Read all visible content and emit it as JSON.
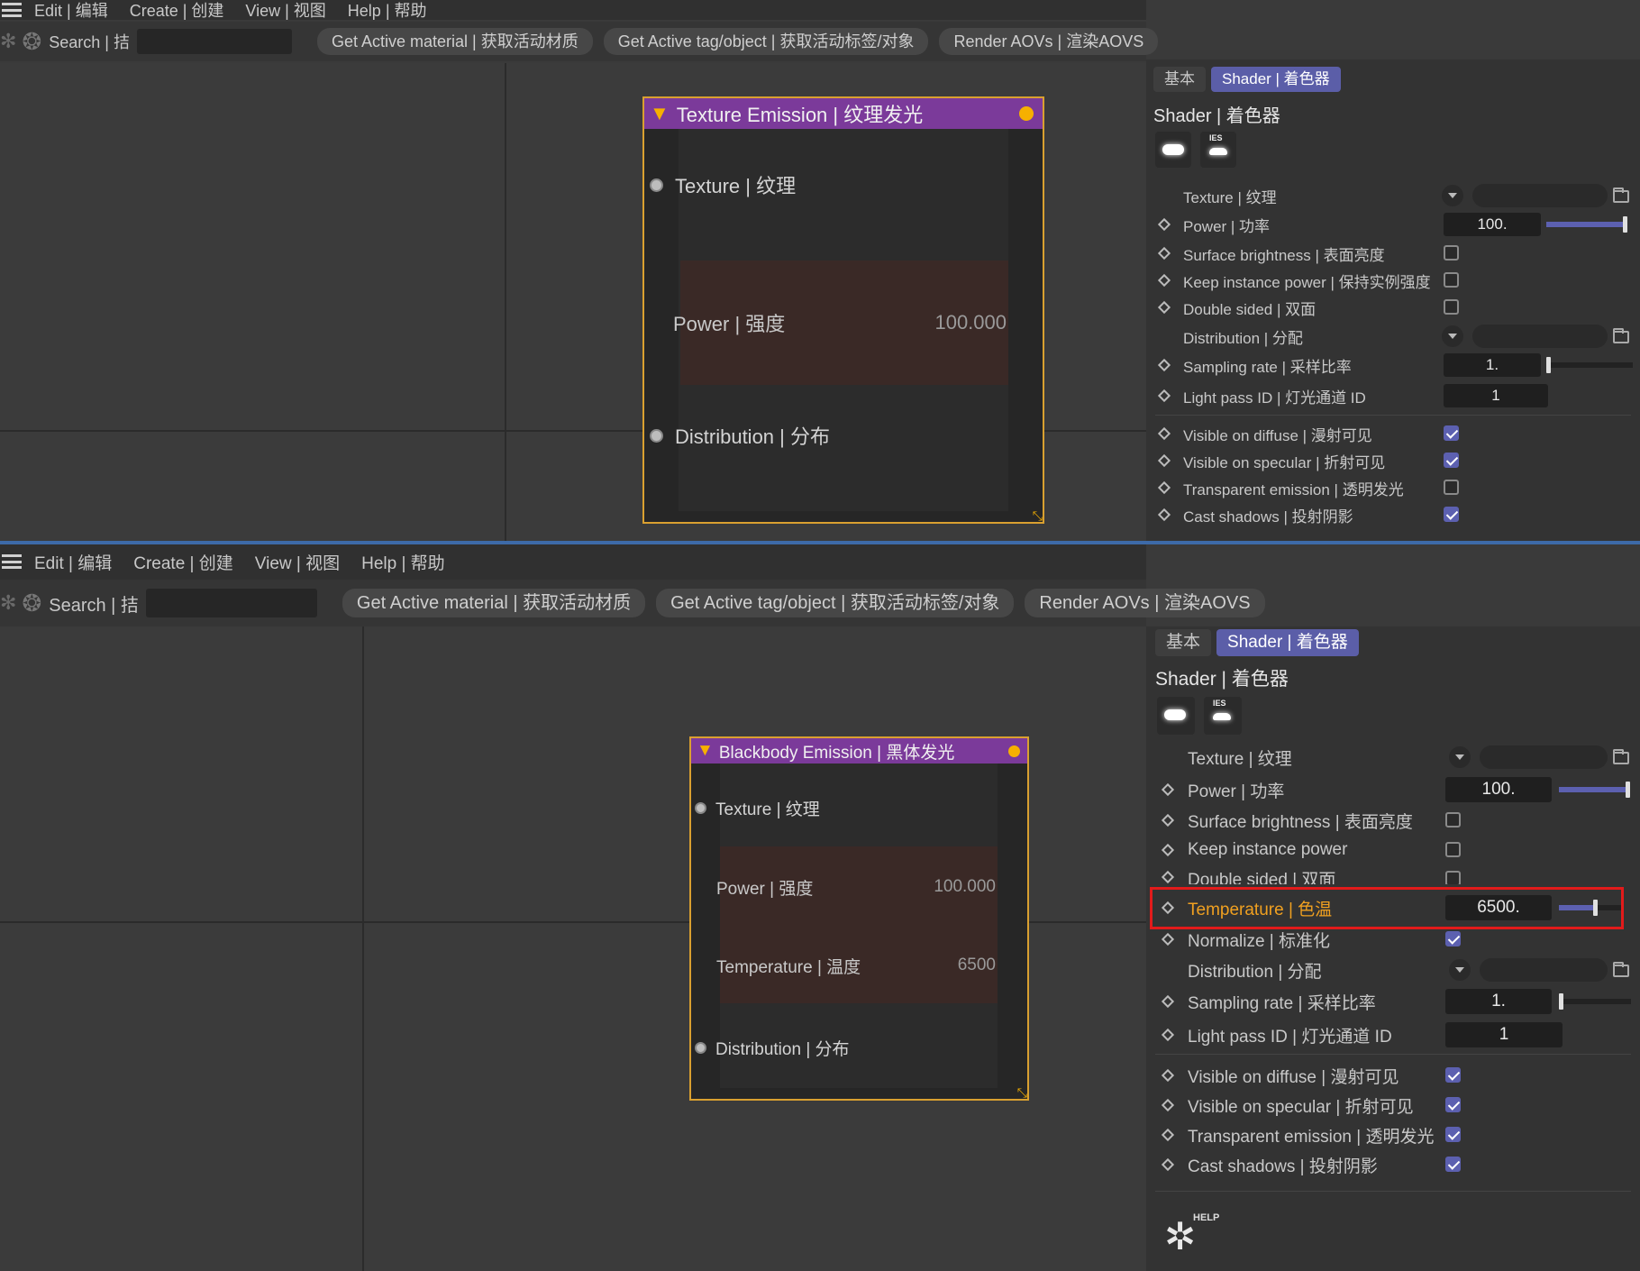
{
  "panelA": {
    "menu": [
      "Edit | 编辑",
      "Create | 创建",
      "View | 视图",
      "Help | 帮助"
    ],
    "search_label": "Search | 拮",
    "search_value": "",
    "toolbar_buttons": [
      "Get Active material | 获取活动材质",
      "Get Active tag/object | 获取活动标签/对象",
      "Render AOVs | 渲染AOVS"
    ],
    "node": {
      "title": "Texture Emission | 纹理发光",
      "texture_label": "Texture | 纹理",
      "power_label": "Power | 强度",
      "power_value": "100.000",
      "distribution_label": "Distribution | 分布"
    },
    "tabs": [
      "基本",
      "Shader | 着色器"
    ],
    "section_title": "Shader | 着色器",
    "props": {
      "texture": "Texture | 纹理",
      "power": "Power | 功率",
      "power_value": "100.",
      "surface_brightness": "Surface brightness | 表面亮度",
      "keep_instance_power": "Keep instance power | 保持实例强度",
      "double_sided": "Double sided | 双面",
      "distribution": "Distribution | 分配",
      "sampling_rate": "Sampling rate | 采样比率",
      "sampling_rate_value": "1.",
      "light_pass_id": "Light pass ID | 灯光通道 ID",
      "light_pass_id_value": "1",
      "visible_diffuse": "Visible on diffuse | 漫射可见",
      "visible_specular": "Visible on specular | 折射可见",
      "transparent_emission": "Transparent emission | 透明发光",
      "cast_shadows": "Cast shadows | 投射阴影"
    },
    "checks": {
      "surface_brightness": false,
      "keep_instance_power": false,
      "double_sided": false,
      "visible_diffuse": true,
      "visible_specular": true,
      "transparent_emission": false,
      "cast_shadows": true
    }
  },
  "panelB": {
    "menu": [
      "Edit | 编辑",
      "Create | 创建",
      "View | 视图",
      "Help | 帮助"
    ],
    "search_label": "Search | 拮",
    "search_value": "",
    "toolbar_buttons": [
      "Get Active material | 获取活动材质",
      "Get Active tag/object | 获取活动标签/对象",
      "Render AOVs | 渲染AOVS"
    ],
    "node": {
      "title": "Blackbody Emission | 黑体发光",
      "texture_label": "Texture | 纹理",
      "power_label": "Power | 强度",
      "power_value": "100.000",
      "temperature_label": "Temperature | 温度",
      "temperature_value": "6500",
      "distribution_label": "Distribution | 分布"
    },
    "tabs": [
      "基本",
      "Shader | 着色器"
    ],
    "section_title": "Shader | 着色器",
    "props": {
      "texture": "Texture | 纹理",
      "power": "Power | 功率",
      "power_value": "100.",
      "surface_brightness": "Surface brightness | 表面亮度",
      "keep_instance_power": "Keep instance power",
      "double_sided": "Double sided | 双面",
      "temperature": "Temperature | 色温",
      "temperature_value": "6500.",
      "normalize": "Normalize | 标准化",
      "distribution": "Distribution | 分配",
      "sampling_rate": "Sampling rate | 采样比率",
      "sampling_rate_value": "1.",
      "light_pass_id": "Light pass ID | 灯光通道 ID",
      "light_pass_id_value": "1",
      "visible_diffuse": "Visible on diffuse | 漫射可见",
      "visible_specular": "Visible on specular | 折射可见",
      "transparent_emission": "Transparent emission | 透明发光",
      "cast_shadows": "Cast shadows | 投射阴影"
    },
    "checks": {
      "surface_brightness": false,
      "keep_instance_power": false,
      "double_sided": false,
      "normalize": true,
      "visible_diffuse": true,
      "visible_specular": true,
      "transparent_emission": true,
      "cast_shadows": true
    },
    "help_label": "HELP"
  },
  "colors": {
    "accent": "#5c60b0",
    "node_header": "#7b3a9a",
    "node_border": "#d9a030",
    "highlight_text": "#f0a020",
    "highlight_box": "#e21b1b"
  }
}
